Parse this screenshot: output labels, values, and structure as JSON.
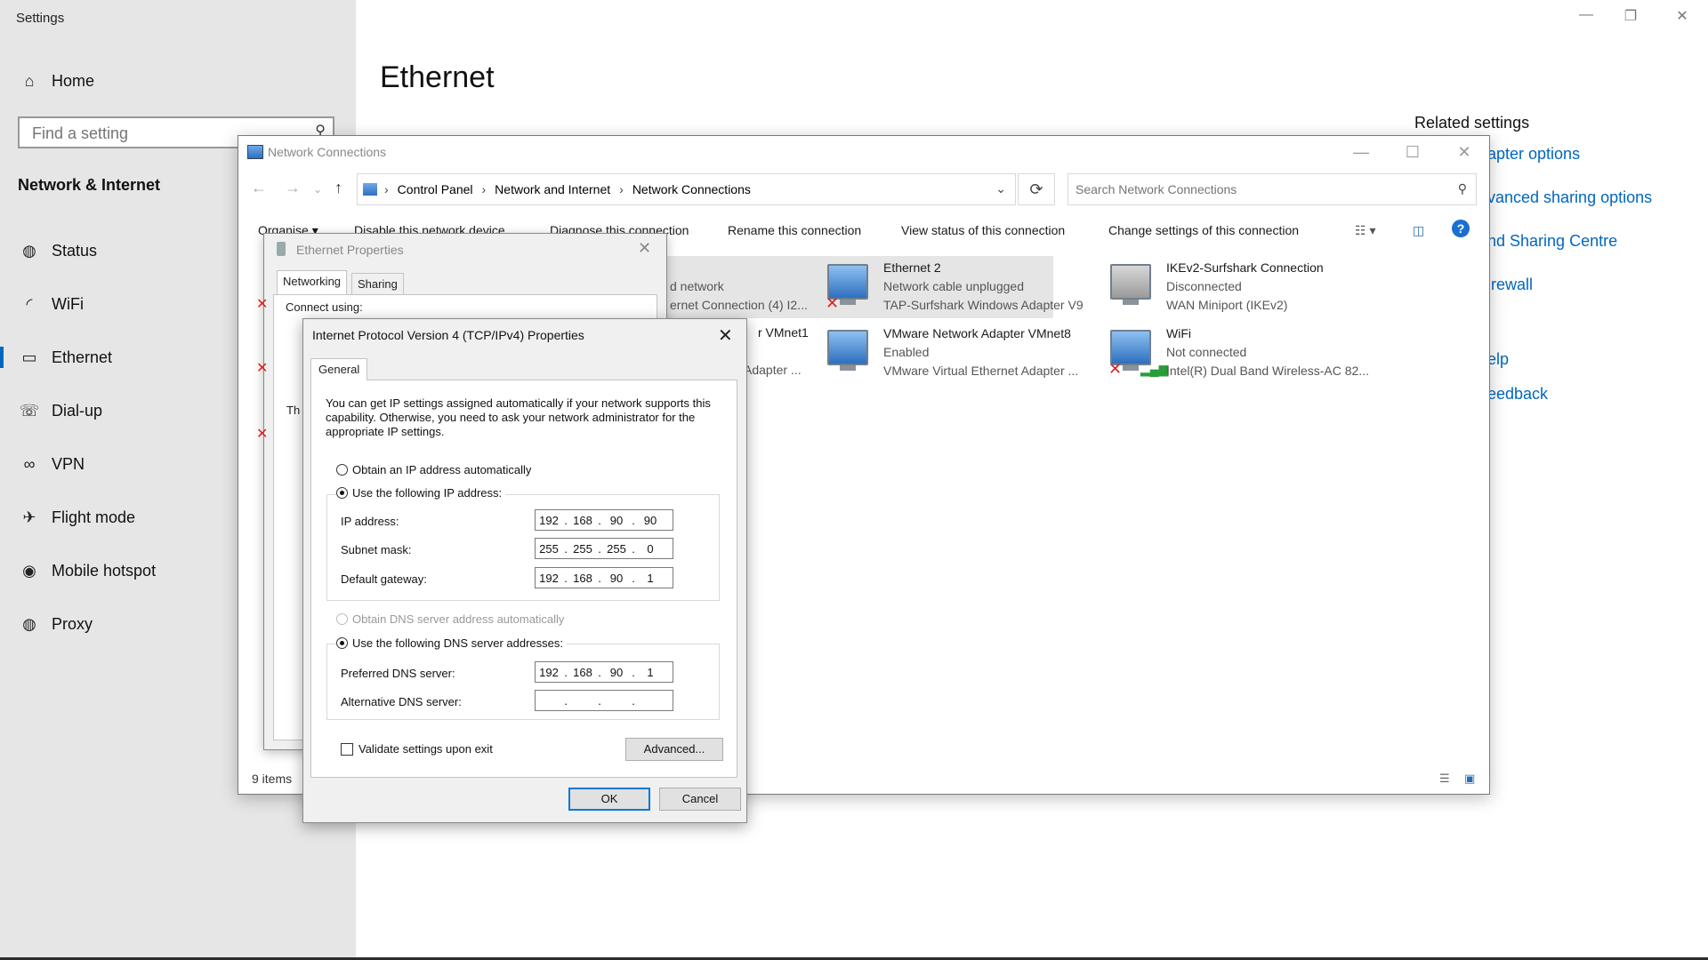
{
  "settings": {
    "title": "Settings",
    "home": "Home",
    "search_placeholder": "Find a setting",
    "section": "Network & Internet",
    "nav": [
      "Status",
      "WiFi",
      "Ethernet",
      "Dial-up",
      "VPN",
      "Flight mode",
      "Mobile hotspot",
      "Proxy"
    ],
    "page_title": "Ethernet",
    "related_title": "Related settings",
    "related_links": [
      "apter options",
      "vanced sharing options",
      "nd Sharing Centre",
      "irewall",
      "elp",
      "eedback"
    ]
  },
  "network_connections": {
    "title": "Network Connections",
    "breadcrumb": [
      "Control Panel",
      "Network and Internet",
      "Network Connections"
    ],
    "search_placeholder": "Search Network Connections",
    "commands": [
      "Organise ▾",
      "Disable this network device",
      "Diagnose this connection",
      "Rename this connection",
      "View status of this connection",
      "Change settings of this connection"
    ],
    "status_count": "9 items",
    "partial_items": {
      "a_line2": "d network",
      "a_line3": "ernet Connection (4) I2...",
      "b_name": "r VMnet1",
      "b_line3": "Adapter ..."
    },
    "items": [
      {
        "name": "Ethernet 2",
        "status": "Network cable unplugged",
        "device": "TAP-Surfshark Windows Adapter V9"
      },
      {
        "name": "IKEv2-Surfshark Connection",
        "status": "Disconnected",
        "device": "WAN Miniport (IKEv2)"
      },
      {
        "name": "VMware Network Adapter VMnet8",
        "status": "Enabled",
        "device": "VMware Virtual Ethernet Adapter ..."
      },
      {
        "name": "WiFi",
        "status": "Not connected",
        "device": "Intel(R) Dual Band Wireless-AC 82..."
      }
    ]
  },
  "ethernet_properties": {
    "title": "Ethernet Properties",
    "tabs": [
      "Networking",
      "Sharing"
    ],
    "frag_connect": "Connect using:",
    "frag_th": "Th"
  },
  "ipv4": {
    "title": "Internet Protocol Version 4 (TCP/IPv4) Properties",
    "tab": "General",
    "intro": "You can get IP settings assigned automatically if your network supports this capability. Otherwise, you need to ask your network administrator for the appropriate IP settings.",
    "obtain_ip_auto": "Obtain an IP address automatically",
    "use_following_ip": "Use the following IP address:",
    "ip_label": "IP address:",
    "ip": [
      "192",
      "168",
      "90",
      "90"
    ],
    "subnet_label": "Subnet mask:",
    "subnet": [
      "255",
      "255",
      "255",
      "0"
    ],
    "gateway_label": "Default gateway:",
    "gateway": [
      "192",
      "168",
      "90",
      "1"
    ],
    "obtain_dns_auto": "Obtain DNS server address automatically",
    "use_following_dns": "Use the following DNS server addresses:",
    "preferred_dns_label": "Preferred DNS server:",
    "preferred_dns": [
      "192",
      "168",
      "90",
      "1"
    ],
    "alternate_dns_label": "Alternative DNS server:",
    "alternate_dns": [
      "",
      "",
      "",
      ""
    ],
    "validate_label": "Validate settings upon exit",
    "advanced": "Advanced...",
    "ok": "OK",
    "cancel": "Cancel"
  }
}
